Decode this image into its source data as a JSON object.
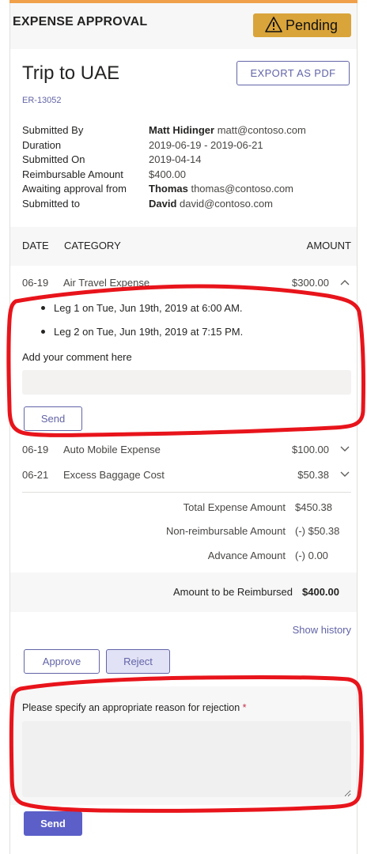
{
  "header": {
    "title": "EXPENSE APPROVAL",
    "status_badge": "Pending",
    "colors": {
      "accent_bar": "#f0a04a",
      "badge": "#d9a43a",
      "brand": "#6264a7"
    }
  },
  "report": {
    "title": "Trip to UAE",
    "id": "ER-13052",
    "export_label": "EXPORT AS PDF"
  },
  "facts": [
    {
      "key": "Submitted By",
      "name": "Matt Hidinger",
      "value": "matt@contoso.com"
    },
    {
      "key": "Duration",
      "name": "",
      "value": "2019-06-19 - 2019-06-21"
    },
    {
      "key": "Submitted On",
      "name": "",
      "value": "2019-04-14"
    },
    {
      "key": "Reimbursable Amount",
      "name": "",
      "value": "$400.00"
    },
    {
      "key": "Awaiting approval from",
      "name": "Thomas",
      "value": "thomas@contoso.com"
    },
    {
      "key": "Submitted to",
      "name": "David",
      "value": "david@contoso.com"
    }
  ],
  "table": {
    "headers": {
      "date": "DATE",
      "category": "CATEGORY",
      "amount": "AMOUNT"
    },
    "rows": [
      {
        "date": "06-19",
        "category": "Air Travel Expense",
        "amount": "$300.00",
        "expanded": true,
        "icon": "chevron-up-icon"
      },
      {
        "date": "06-19",
        "category": "Auto Mobile Expense",
        "amount": "$100.00",
        "expanded": false,
        "icon": "chevron-down-icon"
      },
      {
        "date": "06-21",
        "category": "Excess Baggage Cost",
        "amount": "$50.38",
        "expanded": false,
        "icon": "chevron-down-icon"
      }
    ],
    "legs": [
      "Leg 1 on Tue, Jun 19th, 2019 at 6:00 AM.",
      "Leg 2 on Tue, Jun 19th, 2019 at 7:15 PM."
    ],
    "comment_label": "Add your comment here",
    "comment_value": "",
    "send_label": "Send"
  },
  "totals": [
    {
      "label": "Total Expense Amount",
      "value": "$450.38"
    },
    {
      "label": "Non-reimbursable Amount",
      "value": "(-) $50.38"
    },
    {
      "label": "Advance Amount",
      "value": "(-) 0.00"
    }
  ],
  "reimbursement": {
    "label": "Amount to be Reimbursed",
    "value": "$400.00"
  },
  "actions": {
    "show_history": "Show history",
    "approve": "Approve",
    "reject": "Reject"
  },
  "rejection": {
    "label": "Please specify an appropriate reason for rejection",
    "required_mark": "*",
    "value": "",
    "send_label": "Send"
  },
  "annotations": {
    "color": "#e8141b"
  }
}
